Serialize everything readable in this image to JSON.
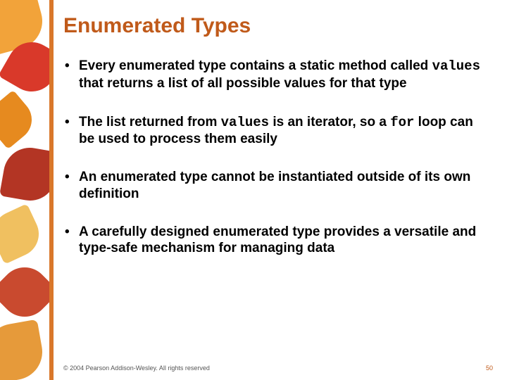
{
  "title": "Enumerated Types",
  "bullets": [
    {
      "pre": "Every enumerated type contains a static method called ",
      "code1": "values",
      "mid": " that returns a list of all possible values for that type",
      "code2": "",
      "post": ""
    },
    {
      "pre": "The list returned from ",
      "code1": "values",
      "mid": " is an iterator, so a ",
      "code2": "for",
      "post": " loop can be used to process them easily"
    },
    {
      "pre": "An enumerated type cannot be instantiated outside of its own definition",
      "code1": "",
      "mid": "",
      "code2": "",
      "post": ""
    },
    {
      "pre": "A carefully designed enumerated type provides a versatile and type-safe mechanism for managing data",
      "code1": "",
      "mid": "",
      "code2": "",
      "post": ""
    }
  ],
  "copyright": "© 2004 Pearson Addison-Wesley. All rights reserved",
  "page_number": "50"
}
